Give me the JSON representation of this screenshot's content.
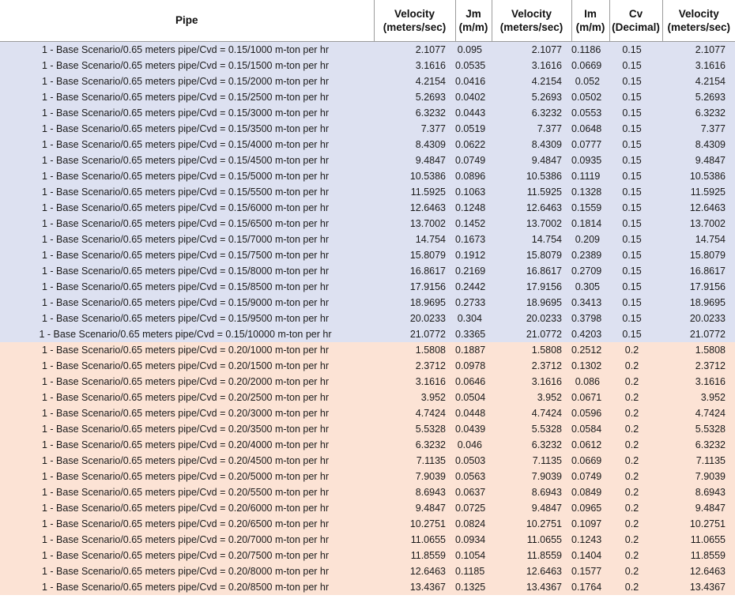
{
  "table": {
    "columns": [
      {
        "id": "pipe",
        "line1": "Pipe",
        "line2": "",
        "align": "center"
      },
      {
        "id": "velocity1",
        "line1": "Velocity",
        "line2": "(meters/sec)",
        "align": "right"
      },
      {
        "id": "jm",
        "line1": "Jm",
        "line2": "(m/m)",
        "align": "right"
      },
      {
        "id": "velocity2",
        "line1": "Velocity",
        "line2": "(meters/sec)",
        "align": "right"
      },
      {
        "id": "im",
        "line1": "Im",
        "line2": "(m/m)",
        "align": "right"
      },
      {
        "id": "cv",
        "line1": "Cv",
        "line2": "(Decimal)",
        "align": "center"
      },
      {
        "id": "velocity3",
        "line1": "Velocity",
        "line2": "(meters/sec)",
        "align": "right"
      }
    ],
    "group_colors": {
      "cvd_015": "#dde1f1",
      "cvd_020": "#fce3d5"
    },
    "rows": [
      {
        "group": "blue",
        "pipe": "1 - Base Scenario/0.65 meters pipe/Cvd = 0.15/1000 m-ton per hr",
        "velocity1": "2.1077",
        "jm": "0.095",
        "velocity2": "2.1077",
        "im": "0.1186",
        "cv": "0.15",
        "velocity3": "2.1077"
      },
      {
        "group": "blue",
        "pipe": "1 - Base Scenario/0.65 meters pipe/Cvd = 0.15/1500 m-ton per hr",
        "velocity1": "3.1616",
        "jm": "0.0535",
        "velocity2": "3.1616",
        "im": "0.0669",
        "cv": "0.15",
        "velocity3": "3.1616"
      },
      {
        "group": "blue",
        "pipe": "1 - Base Scenario/0.65 meters pipe/Cvd = 0.15/2000 m-ton per hr",
        "velocity1": "4.2154",
        "jm": "0.0416",
        "velocity2": "4.2154",
        "im": "0.052",
        "cv": "0.15",
        "velocity3": "4.2154"
      },
      {
        "group": "blue",
        "pipe": "1 - Base Scenario/0.65 meters pipe/Cvd = 0.15/2500 m-ton per hr",
        "velocity1": "5.2693",
        "jm": "0.0402",
        "velocity2": "5.2693",
        "im": "0.0502",
        "cv": "0.15",
        "velocity3": "5.2693"
      },
      {
        "group": "blue",
        "pipe": "1 - Base Scenario/0.65 meters pipe/Cvd = 0.15/3000 m-ton per hr",
        "velocity1": "6.3232",
        "jm": "0.0443",
        "velocity2": "6.3232",
        "im": "0.0553",
        "cv": "0.15",
        "velocity3": "6.3232"
      },
      {
        "group": "blue",
        "pipe": "1 - Base Scenario/0.65 meters pipe/Cvd = 0.15/3500 m-ton per hr",
        "velocity1": "7.377",
        "jm": "0.0519",
        "velocity2": "7.377",
        "im": "0.0648",
        "cv": "0.15",
        "velocity3": "7.377"
      },
      {
        "group": "blue",
        "pipe": "1 - Base Scenario/0.65 meters pipe/Cvd = 0.15/4000 m-ton per hr",
        "velocity1": "8.4309",
        "jm": "0.0622",
        "velocity2": "8.4309",
        "im": "0.0777",
        "cv": "0.15",
        "velocity3": "8.4309"
      },
      {
        "group": "blue",
        "pipe": "1 - Base Scenario/0.65 meters pipe/Cvd = 0.15/4500 m-ton per hr",
        "velocity1": "9.4847",
        "jm": "0.0749",
        "velocity2": "9.4847",
        "im": "0.0935",
        "cv": "0.15",
        "velocity3": "9.4847"
      },
      {
        "group": "blue",
        "pipe": "1 - Base Scenario/0.65 meters pipe/Cvd = 0.15/5000 m-ton per hr",
        "velocity1": "10.5386",
        "jm": "0.0896",
        "velocity2": "10.5386",
        "im": "0.1119",
        "cv": "0.15",
        "velocity3": "10.5386"
      },
      {
        "group": "blue",
        "pipe": "1 - Base Scenario/0.65 meters pipe/Cvd = 0.15/5500 m-ton per hr",
        "velocity1": "11.5925",
        "jm": "0.1063",
        "velocity2": "11.5925",
        "im": "0.1328",
        "cv": "0.15",
        "velocity3": "11.5925"
      },
      {
        "group": "blue",
        "pipe": "1 - Base Scenario/0.65 meters pipe/Cvd = 0.15/6000 m-ton per hr",
        "velocity1": "12.6463",
        "jm": "0.1248",
        "velocity2": "12.6463",
        "im": "0.1559",
        "cv": "0.15",
        "velocity3": "12.6463"
      },
      {
        "group": "blue",
        "pipe": "1 - Base Scenario/0.65 meters pipe/Cvd = 0.15/6500 m-ton per hr",
        "velocity1": "13.7002",
        "jm": "0.1452",
        "velocity2": "13.7002",
        "im": "0.1814",
        "cv": "0.15",
        "velocity3": "13.7002"
      },
      {
        "group": "blue",
        "pipe": "1 - Base Scenario/0.65 meters pipe/Cvd = 0.15/7000 m-ton per hr",
        "velocity1": "14.754",
        "jm": "0.1673",
        "velocity2": "14.754",
        "im": "0.209",
        "cv": "0.15",
        "velocity3": "14.754"
      },
      {
        "group": "blue",
        "pipe": "1 - Base Scenario/0.65 meters pipe/Cvd = 0.15/7500 m-ton per hr",
        "velocity1": "15.8079",
        "jm": "0.1912",
        "velocity2": "15.8079",
        "im": "0.2389",
        "cv": "0.15",
        "velocity3": "15.8079"
      },
      {
        "group": "blue",
        "pipe": "1 - Base Scenario/0.65 meters pipe/Cvd = 0.15/8000 m-ton per hr",
        "velocity1": "16.8617",
        "jm": "0.2169",
        "velocity2": "16.8617",
        "im": "0.2709",
        "cv": "0.15",
        "velocity3": "16.8617"
      },
      {
        "group": "blue",
        "pipe": "1 - Base Scenario/0.65 meters pipe/Cvd = 0.15/8500 m-ton per hr",
        "velocity1": "17.9156",
        "jm": "0.2442",
        "velocity2": "17.9156",
        "im": "0.305",
        "cv": "0.15",
        "velocity3": "17.9156"
      },
      {
        "group": "blue",
        "pipe": "1 - Base Scenario/0.65 meters pipe/Cvd = 0.15/9000 m-ton per hr",
        "velocity1": "18.9695",
        "jm": "0.2733",
        "velocity2": "18.9695",
        "im": "0.3413",
        "cv": "0.15",
        "velocity3": "18.9695"
      },
      {
        "group": "blue",
        "pipe": "1 - Base Scenario/0.65 meters pipe/Cvd = 0.15/9500 m-ton per hr",
        "velocity1": "20.0233",
        "jm": "0.304",
        "velocity2": "20.0233",
        "im": "0.3798",
        "cv": "0.15",
        "velocity3": "20.0233"
      },
      {
        "group": "blue",
        "pipe": "1 - Base Scenario/0.65 meters pipe/Cvd = 0.15/10000 m-ton per hr",
        "velocity1": "21.0772",
        "jm": "0.3365",
        "velocity2": "21.0772",
        "im": "0.4203",
        "cv": "0.15",
        "velocity3": "21.0772"
      },
      {
        "group": "peach",
        "pipe": "1 - Base Scenario/0.65 meters pipe/Cvd = 0.20/1000 m-ton per hr",
        "velocity1": "1.5808",
        "jm": "0.1887",
        "velocity2": "1.5808",
        "im": "0.2512",
        "cv": "0.2",
        "velocity3": "1.5808"
      },
      {
        "group": "peach",
        "pipe": "1 - Base Scenario/0.65 meters pipe/Cvd = 0.20/1500 m-ton per hr",
        "velocity1": "2.3712",
        "jm": "0.0978",
        "velocity2": "2.3712",
        "im": "0.1302",
        "cv": "0.2",
        "velocity3": "2.3712"
      },
      {
        "group": "peach",
        "pipe": "1 - Base Scenario/0.65 meters pipe/Cvd = 0.20/2000 m-ton per hr",
        "velocity1": "3.1616",
        "jm": "0.0646",
        "velocity2": "3.1616",
        "im": "0.086",
        "cv": "0.2",
        "velocity3": "3.1616"
      },
      {
        "group": "peach",
        "pipe": "1 - Base Scenario/0.65 meters pipe/Cvd = 0.20/2500 m-ton per hr",
        "velocity1": "3.952",
        "jm": "0.0504",
        "velocity2": "3.952",
        "im": "0.0671",
        "cv": "0.2",
        "velocity3": "3.952"
      },
      {
        "group": "peach",
        "pipe": "1 - Base Scenario/0.65 meters pipe/Cvd = 0.20/3000 m-ton per hr",
        "velocity1": "4.7424",
        "jm": "0.0448",
        "velocity2": "4.7424",
        "im": "0.0596",
        "cv": "0.2",
        "velocity3": "4.7424"
      },
      {
        "group": "peach",
        "pipe": "1 - Base Scenario/0.65 meters pipe/Cvd = 0.20/3500 m-ton per hr",
        "velocity1": "5.5328",
        "jm": "0.0439",
        "velocity2": "5.5328",
        "im": "0.0584",
        "cv": "0.2",
        "velocity3": "5.5328"
      },
      {
        "group": "peach",
        "pipe": "1 - Base Scenario/0.65 meters pipe/Cvd = 0.20/4000 m-ton per hr",
        "velocity1": "6.3232",
        "jm": "0.046",
        "velocity2": "6.3232",
        "im": "0.0612",
        "cv": "0.2",
        "velocity3": "6.3232"
      },
      {
        "group": "peach",
        "pipe": "1 - Base Scenario/0.65 meters pipe/Cvd = 0.20/4500 m-ton per hr",
        "velocity1": "7.1135",
        "jm": "0.0503",
        "velocity2": "7.1135",
        "im": "0.0669",
        "cv": "0.2",
        "velocity3": "7.1135"
      },
      {
        "group": "peach",
        "pipe": "1 - Base Scenario/0.65 meters pipe/Cvd = 0.20/5000 m-ton per hr",
        "velocity1": "7.9039",
        "jm": "0.0563",
        "velocity2": "7.9039",
        "im": "0.0749",
        "cv": "0.2",
        "velocity3": "7.9039"
      },
      {
        "group": "peach",
        "pipe": "1 - Base Scenario/0.65 meters pipe/Cvd = 0.20/5500 m-ton per hr",
        "velocity1": "8.6943",
        "jm": "0.0637",
        "velocity2": "8.6943",
        "im": "0.0849",
        "cv": "0.2",
        "velocity3": "8.6943"
      },
      {
        "group": "peach",
        "pipe": "1 - Base Scenario/0.65 meters pipe/Cvd = 0.20/6000 m-ton per hr",
        "velocity1": "9.4847",
        "jm": "0.0725",
        "velocity2": "9.4847",
        "im": "0.0965",
        "cv": "0.2",
        "velocity3": "9.4847"
      },
      {
        "group": "peach",
        "pipe": "1 - Base Scenario/0.65 meters pipe/Cvd = 0.20/6500 m-ton per hr",
        "velocity1": "10.2751",
        "jm": "0.0824",
        "velocity2": "10.2751",
        "im": "0.1097",
        "cv": "0.2",
        "velocity3": "10.2751"
      },
      {
        "group": "peach",
        "pipe": "1 - Base Scenario/0.65 meters pipe/Cvd = 0.20/7000 m-ton per hr",
        "velocity1": "11.0655",
        "jm": "0.0934",
        "velocity2": "11.0655",
        "im": "0.1243",
        "cv": "0.2",
        "velocity3": "11.0655"
      },
      {
        "group": "peach",
        "pipe": "1 - Base Scenario/0.65 meters pipe/Cvd = 0.20/7500 m-ton per hr",
        "velocity1": "11.8559",
        "jm": "0.1054",
        "velocity2": "11.8559",
        "im": "0.1404",
        "cv": "0.2",
        "velocity3": "11.8559"
      },
      {
        "group": "peach",
        "pipe": "1 - Base Scenario/0.65 meters pipe/Cvd = 0.20/8000 m-ton per hr",
        "velocity1": "12.6463",
        "jm": "0.1185",
        "velocity2": "12.6463",
        "im": "0.1577",
        "cv": "0.2",
        "velocity3": "12.6463"
      },
      {
        "group": "peach",
        "pipe": "1 - Base Scenario/0.65 meters pipe/Cvd = 0.20/8500 m-ton per hr",
        "velocity1": "13.4367",
        "jm": "0.1325",
        "velocity2": "13.4367",
        "im": "0.1764",
        "cv": "0.2",
        "velocity3": "13.4367"
      }
    ]
  }
}
